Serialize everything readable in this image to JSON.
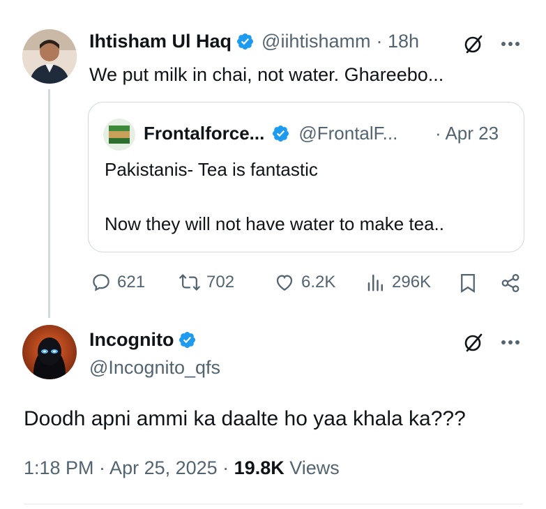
{
  "parent_tweet": {
    "author_name": "Ihtisham Ul Haq",
    "handle": "@iihtishamm",
    "time": "· 18h",
    "text": "We put milk in chai, not water. Ghareebo...",
    "quoted": {
      "author_name": "Frontalforce...",
      "handle": "@FrontalF...",
      "time": "· Apr 23",
      "line1": "Pakistanis- Tea is fantastic",
      "line2": "Now they will not have water to make tea.."
    },
    "actions": {
      "replies": "621",
      "reposts": "702",
      "likes": "6.2K",
      "views": "296K"
    }
  },
  "main_tweet": {
    "author_name": "Incognito",
    "handle": "@Incognito_qfs",
    "text": "Doodh apni ammi ka daalte ho yaa khala ka???",
    "timestamp": "1:18 PM · Apr 25, 2025 · ",
    "views_count": "19.8K",
    "views_label": " Views"
  },
  "colors": {
    "verified_blue": "#1d9bf0",
    "secondary_text": "#536471",
    "primary_text": "#0f1419"
  },
  "icons": [
    "verified-icon",
    "grok-icon",
    "more-icon",
    "reply-icon",
    "repost-icon",
    "like-icon",
    "views-icon",
    "bookmark-icon",
    "share-icon"
  ]
}
